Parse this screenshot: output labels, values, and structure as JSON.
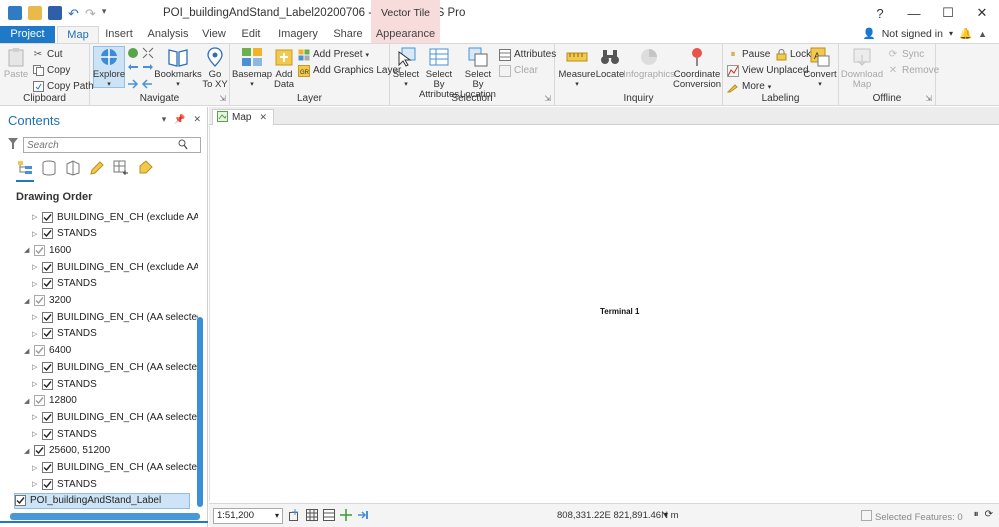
{
  "window": {
    "title": "POI_buildingAndStand_Label20200706 - Map - ArcGIS Pro",
    "context_tab_group": "Vector Tile Layer",
    "controls": {
      "help": "?",
      "minimize": "—",
      "restore": "☐",
      "close": "✕"
    }
  },
  "tabs": [
    {
      "label": "Project"
    },
    {
      "label": "Map"
    },
    {
      "label": "Insert"
    },
    {
      "label": "Analysis"
    },
    {
      "label": "View"
    },
    {
      "label": "Edit"
    },
    {
      "label": "Imagery"
    },
    {
      "label": "Share"
    },
    {
      "label": "Appearance"
    }
  ],
  "user": {
    "status": "Not signed in",
    "arrow": "▾"
  },
  "ribbon": {
    "clipboard": {
      "label": "Clipboard",
      "paste": "Paste",
      "cut": "Cut",
      "copy": "Copy",
      "copy_path": "Copy Path"
    },
    "navigate": {
      "label": "Navigate",
      "explore": "Explore",
      "bookmarks": "Bookmarks",
      "goto_line1": "Go",
      "goto_line2": "To XY"
    },
    "layer": {
      "label": "Layer",
      "basemap": "Basemap",
      "add_data_line1": "Add",
      "add_data_line2": "Data",
      "add_preset": "Add Preset",
      "add_graphics": "Add Graphics Layer"
    },
    "selection": {
      "label": "Selection",
      "select": "Select",
      "select_attr_line1": "Select By",
      "select_attr_line2": "Attributes",
      "select_loc_line1": "Select By",
      "select_loc_line2": "Location",
      "attributes": "Attributes",
      "clear": "Clear"
    },
    "inquiry": {
      "label": "Inquiry",
      "measure": "Measure",
      "locate": "Locate",
      "infographics": "Infographics",
      "coord_line1": "Coordinate",
      "coord_line2": "Conversion"
    },
    "labeling": {
      "label": "Labeling",
      "pause": "Pause",
      "lock": "Lock",
      "view_unplaced": "View Unplaced",
      "more": "More",
      "convert": "Convert"
    },
    "offline": {
      "label": "Offline",
      "download_line1": "Download",
      "download_line2": "Map",
      "sync": "Sync",
      "remove": "Remove"
    }
  },
  "contents": {
    "title": "Contents",
    "search_placeholder": "Search",
    "section": "Drawing Order",
    "rows": [
      {
        "label": "BUILDING_EN_CH (exclude AA covered",
        "level": 2,
        "checked": true
      },
      {
        "label": "STANDS",
        "level": 2,
        "checked": true
      },
      {
        "label": "1600",
        "level": 1,
        "checked": true
      },
      {
        "label": "BUILDING_EN_CH (exclude AA covered",
        "level": 2,
        "checked": true
      },
      {
        "label": "STANDS",
        "level": 2,
        "checked": true
      },
      {
        "label": "3200",
        "level": 1,
        "checked": true
      },
      {
        "label": "BUILDING_EN_CH (AA selected)",
        "level": 2,
        "checked": true
      },
      {
        "label": "STANDS",
        "level": 2,
        "checked": true
      },
      {
        "label": "6400",
        "level": 1,
        "checked": true
      },
      {
        "label": "BUILDING_EN_CH (AA selected)",
        "level": 2,
        "checked": true
      },
      {
        "label": "STANDS",
        "level": 2,
        "checked": true
      },
      {
        "label": "12800",
        "level": 1,
        "checked": true
      },
      {
        "label": "BUILDING_EN_CH (AA selected)",
        "level": 2,
        "checked": true
      },
      {
        "label": "STANDS",
        "level": 2,
        "checked": true
      },
      {
        "label": "25600, 51200",
        "level": 1,
        "checked": true
      },
      {
        "label": "BUILDING_EN_CH (AA selected)",
        "level": 2,
        "checked": true
      },
      {
        "label": "STANDS",
        "level": 2,
        "checked": true
      },
      {
        "label": "POI_buildingAndStand_Label",
        "level": 0,
        "checked": true,
        "selected": true
      }
    ]
  },
  "map": {
    "tab_label": "Map",
    "feature_label": "Terminal 1",
    "scale": "1:51,200",
    "coordinates": "808,331.22E 821,891.46N m",
    "selected_features": "Selected Features: 0"
  },
  "colors": {
    "accent": "#1e7ac8",
    "context_tab": "#f8dcdc",
    "selection": "#cde4f7"
  }
}
